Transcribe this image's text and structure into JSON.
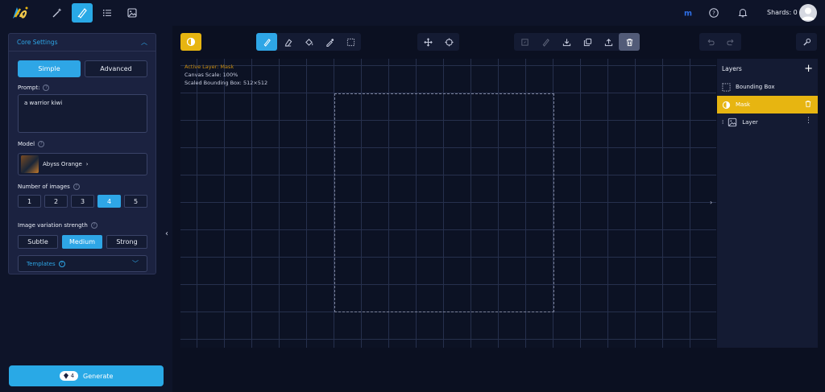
{
  "topbar": {
    "shards_label": "Shards: 0",
    "nav": [
      "magic-wand-icon",
      "brush-icon",
      "list-icon",
      "image-icon"
    ],
    "active_nav": 1
  },
  "core_settings": {
    "title": "Core Settings",
    "mode_simple": "Simple",
    "mode_advanced": "Advanced",
    "prompt_label": "Prompt:",
    "prompt_value": "a warrior kiwi",
    "model_label": "Model",
    "model_name": "Abyss Orange",
    "num_images_label": "Number of images",
    "num_images_options": [
      "1",
      "2",
      "3",
      "4",
      "5"
    ],
    "num_images_selected": "4",
    "variation_label": "Image variation strength",
    "variation_options": [
      "Subtle",
      "Medium",
      "Strong"
    ],
    "variation_selected": "Medium",
    "templates_label": "Templates"
  },
  "generate": {
    "cost": "4",
    "label": "Generate"
  },
  "canvas": {
    "active_layer": "Active Layer: Mask",
    "scale": "Canvas Scale: 100%",
    "bbox": "Scaled Bounding Box: 512×512"
  },
  "layers": {
    "title": "Layers",
    "items": [
      {
        "name": "Bounding Box",
        "icon": "bounding-box-icon",
        "selected": false
      },
      {
        "name": "Mask",
        "icon": "mask-icon",
        "selected": true
      },
      {
        "name": "Layer",
        "icon": "image-icon",
        "selected": false
      }
    ]
  },
  "colors": {
    "accent": "#2ea6e6",
    "mask_yellow": "#e7b511",
    "bg": "#0b1021",
    "panel": "#1b2240"
  }
}
